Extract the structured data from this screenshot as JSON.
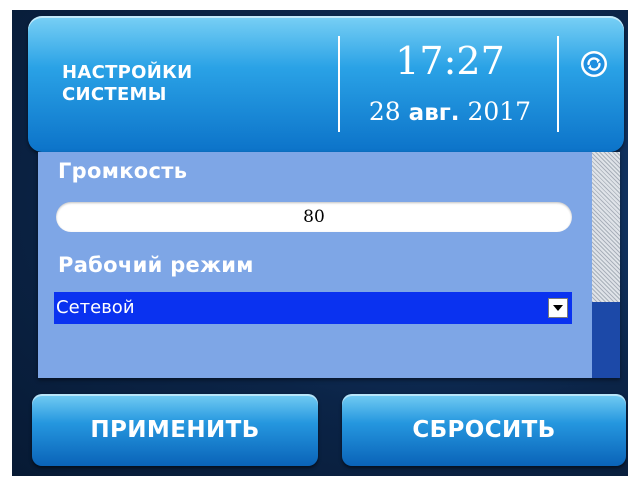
{
  "header": {
    "title_line1": "НАСТРОЙКИ",
    "title_line2": "СИСТЕМЫ",
    "time": "17:27",
    "date_day": "28",
    "date_month": "авг.",
    "date_year": "2017",
    "sync_icon": "sync-icon"
  },
  "settings": {
    "volume_label": "Громкость",
    "volume_value": "80",
    "mode_label": "Рабочий режим",
    "mode_selected": "Сетевой"
  },
  "buttons": {
    "apply_label": "ПРИМЕНИТЬ",
    "reset_label": "СБРОСИТЬ"
  },
  "colors": {
    "header_gradient_top": "#79d0f5",
    "header_gradient_bottom": "#0c73c9",
    "panel_background": "#7ea6e6",
    "select_background": "#0a32f0",
    "screen_background": "#0b2447"
  }
}
